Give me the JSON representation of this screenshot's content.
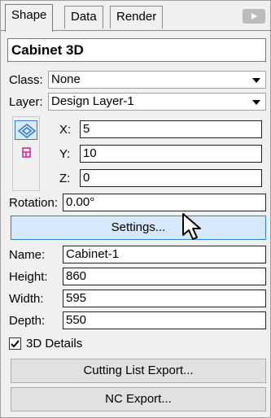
{
  "tabs": [
    {
      "label": "Shape",
      "active": true
    },
    {
      "label": "Data",
      "active": false
    },
    {
      "label": "Render",
      "active": false
    }
  ],
  "object_title": "Cabinet 3D",
  "class": {
    "label": "Class:",
    "value": "None"
  },
  "layer": {
    "label": "Layer:",
    "value": "Design Layer-1"
  },
  "position": {
    "x": {
      "label": "X:",
      "value": "5"
    },
    "y": {
      "label": "Y:",
      "value": "10"
    },
    "z": {
      "label": "Z:",
      "value": "0"
    }
  },
  "rotation": {
    "label": "Rotation:",
    "value": "0.00°"
  },
  "settings_button": "Settings...",
  "fields": {
    "name": {
      "label": "Name:",
      "value": "Cabinet-1"
    },
    "height": {
      "label": "Height:",
      "value": "860"
    },
    "width": {
      "label": "Width:",
      "value": "595"
    },
    "depth": {
      "label": "Depth:",
      "value": "550"
    }
  },
  "details_3d": {
    "label": "3D Details",
    "checked": true
  },
  "cutting_list_button": "Cutting List Export...",
  "nc_export_button": "NC Export...",
  "colors": {
    "accent": "#2b7bd6",
    "hover": "#d6e8fb",
    "panel": "#f0f0f0"
  },
  "icons": [
    "collapse-arrow-icon",
    "3d-view-icon",
    "top-view-icon",
    "dropdown-arrow-icon",
    "mouse-cursor-icon",
    "checkmark-icon"
  ]
}
